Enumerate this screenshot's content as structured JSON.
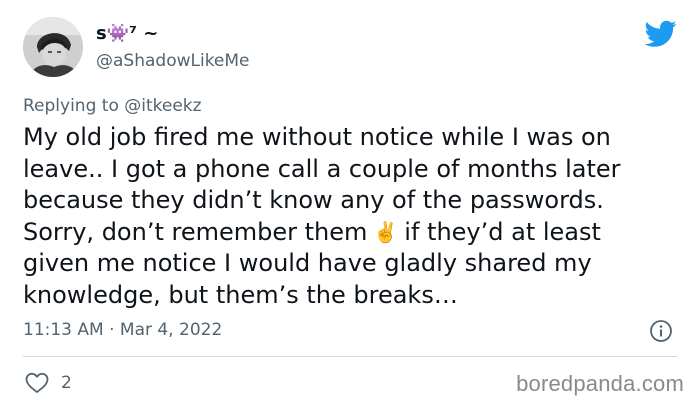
{
  "user": {
    "display_name": "s👾⁷ ⁢⁢⁢⁢⁢~",
    "handle": "@aShadowLikeMe"
  },
  "reply": {
    "prefix": "Replying to",
    "mention": "@itkeekz"
  },
  "tweet": {
    "lines": [
      "My old job fired me without notice while I was on",
      "leave.. I got a phone call a couple of months later",
      "because they didn’t know any of the passwords.",
      "Sorry, don’t remember them",
      "given me notice I would have gladly shared my",
      "knowledge, but them’s the breaks…"
    ],
    "line4_emoji": "✌️",
    "line4_after": "if they’d at least"
  },
  "meta": {
    "timestamp": "11:13 AM · Mar 4, 2022"
  },
  "actions": {
    "like_count": "2"
  },
  "watermark": "boredpanda.com",
  "colors": {
    "twitter_blue": "#1d9bf0",
    "secondary_text": "#536471",
    "primary_text": "#0f1419",
    "divider": "#cfd9de"
  },
  "icons": {
    "brand": "twitter-bird-icon",
    "info": "info-icon",
    "like": "heart-icon"
  }
}
